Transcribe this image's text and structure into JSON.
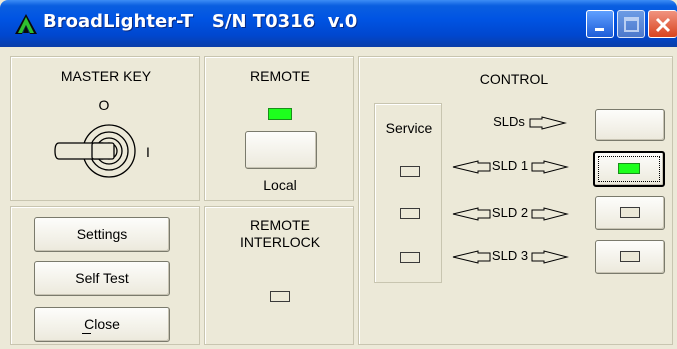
{
  "window": {
    "title": "BroadLighter-T   S/N T0316  v.0",
    "icons": [
      "app-logo-icon",
      "minimize-icon",
      "maximize-icon",
      "close-icon"
    ]
  },
  "master_key": {
    "title": "MASTER KEY",
    "position_off": "O",
    "position_on": "I",
    "icon": "key-switch-icon"
  },
  "remote": {
    "title": "REMOTE",
    "indicator": "on",
    "button_label": "Local"
  },
  "remote_interlock": {
    "title_line1": "REMOTE",
    "title_line2": "INTERLOCK",
    "indicator": "off"
  },
  "actions": {
    "settings": "Settings",
    "self_test": "Self Test",
    "close": "Close"
  },
  "control": {
    "title": "CONTROL",
    "service_label": "Service",
    "rows": [
      {
        "label": "SLDs",
        "arrow_left": false,
        "state": "none"
      },
      {
        "label": "SLD 1",
        "arrow_left": true,
        "state": "on"
      },
      {
        "label": "SLD 2",
        "arrow_left": true,
        "state": "off"
      },
      {
        "label": "SLD 3",
        "arrow_left": true,
        "state": "off"
      }
    ]
  },
  "colors": {
    "led_on": "#1dff1d",
    "led_off": "#ece9d8",
    "titlebar": "#0054e3",
    "window_bg": "#ece9d8"
  }
}
